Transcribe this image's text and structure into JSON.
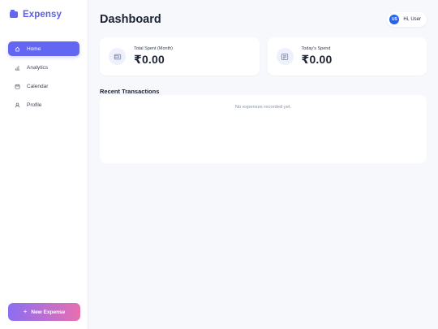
{
  "brand": {
    "name": "Expensy",
    "icon": "folder-icon"
  },
  "sidebar": {
    "items": [
      {
        "label": "Home",
        "icon": "home-icon",
        "active": true
      },
      {
        "label": "Analytics",
        "icon": "bar-chart-icon",
        "active": false
      },
      {
        "label": "Calendar",
        "icon": "calendar-icon",
        "active": false
      },
      {
        "label": "Profile",
        "icon": "user-icon",
        "active": false
      }
    ],
    "new_expense_label": "New Expense",
    "new_expense_icon": "plus-icon"
  },
  "header": {
    "title": "Dashboard",
    "user": {
      "initials": "US",
      "greeting": "Hi, User"
    }
  },
  "stats": [
    {
      "label": "Total Spent (Month)",
      "value": "₹0.00",
      "icon": "wallet-icon"
    },
    {
      "label": "Today's Spend",
      "value": "₹0.00",
      "icon": "receipt-icon"
    }
  ],
  "transactions": {
    "title": "Recent Transactions",
    "empty_message": "No expenses recorded yet."
  },
  "colors": {
    "accent": "#6366f1",
    "gradient_start": "#8b6ef2",
    "gradient_end": "#e86fb0",
    "avatar": "#2563eb",
    "background": "#f7f8fc"
  }
}
